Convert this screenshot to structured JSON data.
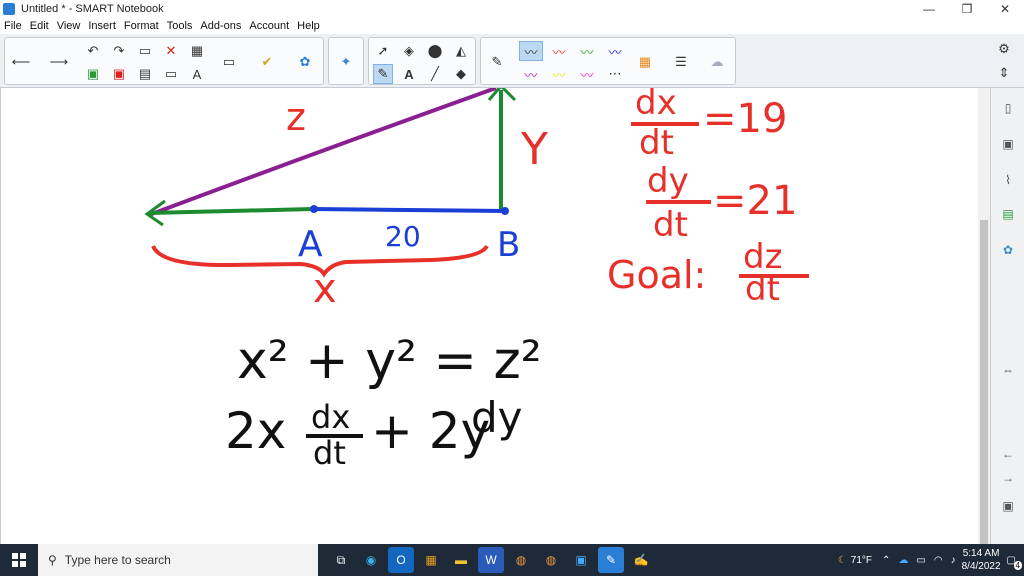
{
  "window": {
    "title": "Untitled * - SMART Notebook",
    "controls": {
      "minimize": "—",
      "maximize": "❐",
      "close": "✕"
    }
  },
  "menu": [
    "File",
    "Edit",
    "View",
    "Insert",
    "Format",
    "Tools",
    "Add-ons",
    "Account",
    "Help"
  ],
  "toolbar": {
    "icons": [
      "back-arrow",
      "forward-arrow",
      "undo",
      "redo",
      "open-file",
      "delete",
      "table",
      "screen-capture",
      "magic-pen",
      "add-on",
      "select",
      "shapes",
      "fill",
      "pens",
      "text",
      "line",
      "eraser",
      "colors"
    ]
  },
  "board": {
    "labels": {
      "z": "z",
      "y": "Y",
      "a": "A",
      "b": "B",
      "twenty": "20",
      "x": "x",
      "rate1_num": "dx",
      "rate1_den": "dt",
      "rate1_val": "=19",
      "rate2_num": "dy",
      "rate2_den": "dt",
      "rate2_val": "=21",
      "goal": "Goal:",
      "goal_num": "dz",
      "goal_den": "dt",
      "eq1": "x² + y² = z²",
      "eq2_a": "2x",
      "eq2_num": "dx",
      "eq2_den": "dt",
      "eq2_b": "+ 2y",
      "eq2_c": "dy"
    },
    "colors": {
      "ink_red": "#e8302a",
      "ink_blue": "#1a3fd6",
      "ink_green": "#1c8a2e",
      "ink_purple": "#8a1f92",
      "ink_black": "#111111"
    }
  },
  "taskbar": {
    "search_placeholder": "Type here to search",
    "weather": "71°F",
    "time": "5:14 AM",
    "date": "8/4/2022",
    "notifications": "4"
  }
}
